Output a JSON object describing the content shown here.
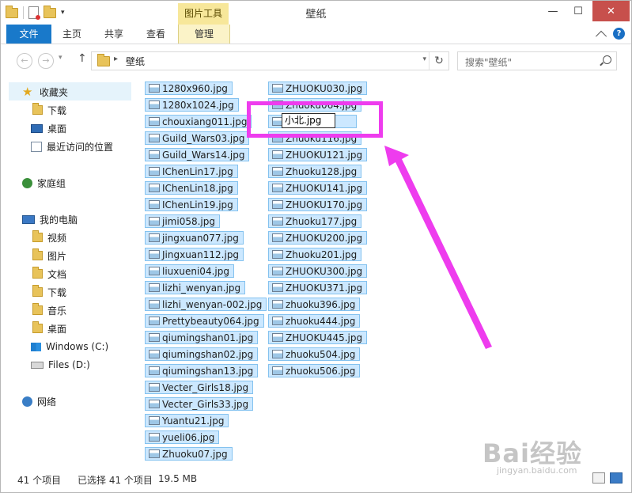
{
  "window": {
    "title": "壁纸",
    "context_tab_group": "图片工具",
    "controls": {
      "minimize": "—",
      "maximize": "☐",
      "close": "✕"
    }
  },
  "ribbon": {
    "tabs": [
      {
        "label": "文件"
      },
      {
        "label": "主页"
      },
      {
        "label": "共享"
      },
      {
        "label": "查看"
      },
      {
        "label": "管理"
      }
    ]
  },
  "address_bar": {
    "back": "←",
    "forward": "→",
    "up": "↑",
    "path": "壁纸",
    "refresh": "↻"
  },
  "search": {
    "placeholder": "搜索\"壁纸\""
  },
  "sidebar": {
    "favorites": {
      "label": "收藏夹",
      "items": [
        {
          "label": "下载"
        },
        {
          "label": "桌面"
        },
        {
          "label": "最近访问的位置"
        }
      ]
    },
    "homegroup": {
      "label": "家庭组"
    },
    "computer": {
      "label": "我的电脑",
      "items": [
        {
          "label": "视频"
        },
        {
          "label": "图片"
        },
        {
          "label": "文档"
        },
        {
          "label": "下载"
        },
        {
          "label": "音乐"
        },
        {
          "label": "桌面"
        },
        {
          "label": "Windows (C:)"
        },
        {
          "label": "Files (D:)"
        }
      ]
    },
    "network": {
      "label": "网络"
    }
  },
  "files": {
    "column1": [
      "1280x960.jpg",
      "1280x1024.jpg",
      "chouxiang011.jpg",
      "Guild_Wars03.jpg",
      "Guild_Wars14.jpg",
      "IChenLin17.jpg",
      "IChenLin18.jpg",
      "IChenLin19.jpg",
      "jimi058.jpg",
      "jingxuan077.jpg",
      "Jingxuan112.jpg",
      "liuxueni04.jpg",
      "lizhi_wenyan.jpg",
      "lizhi_wenyan-002.jpg",
      "Prettybeauty064.jpg",
      "qiumingshan01.jpg",
      "qiumingshan02.jpg",
      "qiumingshan13.jpg",
      "Vecter_Girls18.jpg",
      "Vecter_Girls33.jpg",
      "Yuantu21.jpg",
      "yueli06.jpg",
      "Zhuoku07.jpg"
    ],
    "column2": [
      "ZHUOKU030.jpg",
      "Zhuoku064.jpg",
      "",
      "Zhuoku116.jpg",
      "ZHUOKU121.jpg",
      "Zhuoku128.jpg",
      "ZHUOKU141.jpg",
      "ZHUOKU170.jpg",
      "Zhuoku177.jpg",
      "ZHUOKU200.jpg",
      "Zhuoku201.jpg",
      "ZHUOKU300.jpg",
      "ZHUOKU371.jpg",
      "zhuoku396.jpg",
      "zhuoku444.jpg",
      "ZHUOKU445.jpg",
      "zhuoku504.jpg",
      "zhuoku506.jpg"
    ],
    "rename_value": "小北.jpg"
  },
  "status": {
    "item_count": "41 个项目",
    "selected": "已选择 41 个项目",
    "size": "19.5 MB"
  },
  "watermark": {
    "brand": "Bai经验",
    "url": "jingyan.baidu.com"
  },
  "colors": {
    "file_tab": "#1979ca",
    "selection_fill": "#cce8ff",
    "selection_border": "#84c2ef",
    "annotation": "#ee3cee",
    "close_button": "#c7504c"
  }
}
